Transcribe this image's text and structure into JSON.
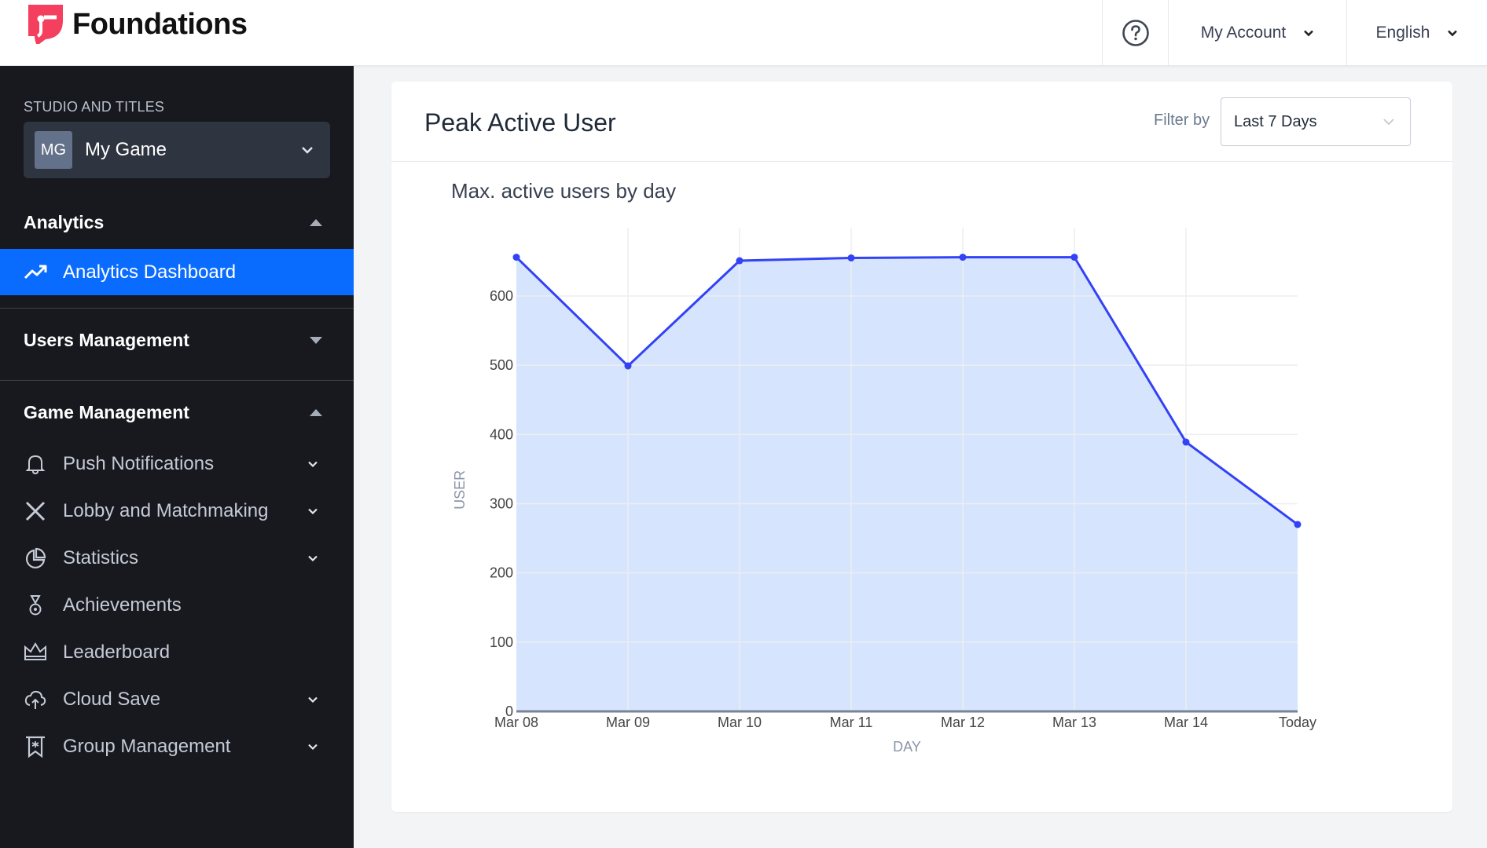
{
  "app": {
    "brand": "Foundations",
    "brand_color": "#f43f5e",
    "accent": "#0a6cff"
  },
  "topbar": {
    "help_icon": "question-circle-icon",
    "account_label": "My Account",
    "language_label": "English"
  },
  "sidebar": {
    "studio_label": "STUDIO AND TITLES",
    "studio": {
      "initials": "MG",
      "name": "My Game"
    },
    "sections": [
      {
        "title": "Analytics",
        "expanded": true,
        "items": [
          {
            "label": "Analytics Dashboard",
            "icon": "trending-up-icon",
            "active": true
          }
        ]
      },
      {
        "title": "Users Management",
        "expanded": false,
        "items": []
      },
      {
        "title": "Game Management",
        "expanded": true,
        "items": [
          {
            "label": "Push Notifications",
            "icon": "bell-icon",
            "has_submenu": true
          },
          {
            "label": "Lobby and Matchmaking",
            "icon": "crossed-swords-icon",
            "has_submenu": true
          },
          {
            "label": "Statistics",
            "icon": "pie-chart-icon",
            "has_submenu": true
          },
          {
            "label": "Achievements",
            "icon": "medal-icon",
            "has_submenu": false
          },
          {
            "label": "Leaderboard",
            "icon": "crown-icon",
            "has_submenu": false
          },
          {
            "label": "Cloud Save",
            "icon": "cloud-upload-icon",
            "has_submenu": true
          },
          {
            "label": "Group Management",
            "icon": "banner-icon",
            "has_submenu": true
          }
        ]
      }
    ]
  },
  "card": {
    "title": "Peak Active User",
    "filter_label": "Filter by",
    "filter_value": "Last 7 Days"
  },
  "chart_data": {
    "type": "area",
    "title": "Max. active users by day",
    "xlabel": "DAY",
    "ylabel": "USER",
    "categories": [
      "Mar 08",
      "Mar 09",
      "Mar 10",
      "Mar 11",
      "Mar 12",
      "Mar 13",
      "Mar 14",
      "Today"
    ],
    "series": [
      {
        "name": "Max active users",
        "values": [
          656,
          499,
          651,
          655,
          656,
          656,
          389,
          270
        ]
      }
    ],
    "yticks": [
      0,
      100,
      200,
      300,
      400,
      500,
      600
    ],
    "ylim": [
      0,
      670
    ],
    "grid": true,
    "line_color": "#3342f5",
    "fill_color": "#d4e4fd"
  }
}
